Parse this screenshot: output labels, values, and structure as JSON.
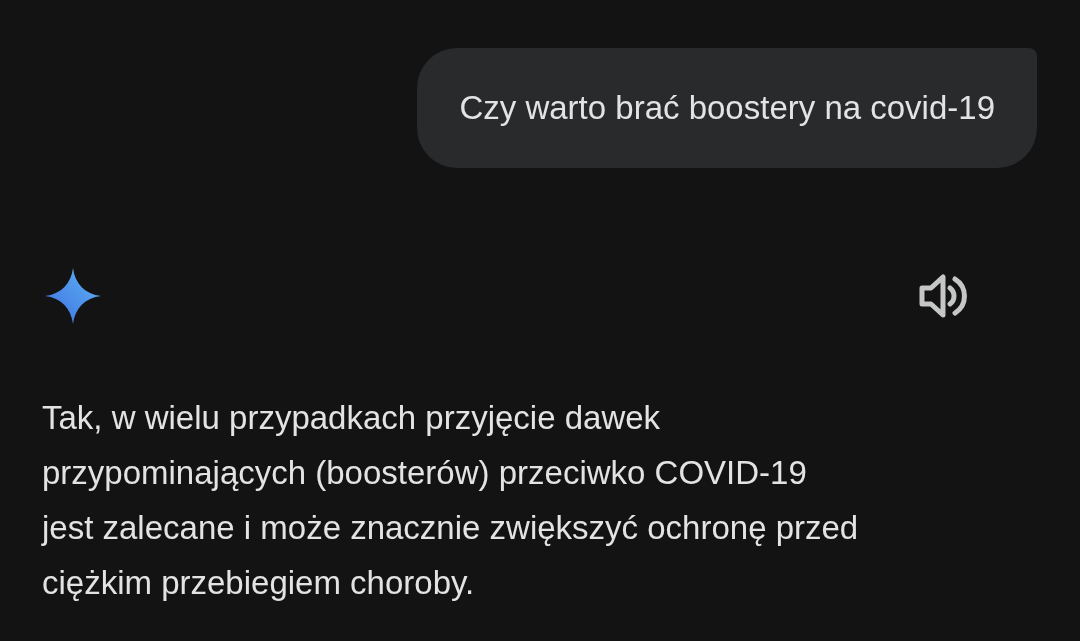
{
  "user_message": {
    "text": "Czy warto brać boostery na covid-19"
  },
  "response": {
    "text": "Tak, w wielu przypadkach przyjęcie dawek\nprzypominających (boosterów) przeciwko COVID-19\njest zalecane i może znacznie zwiększyć ochronę przed\nciężkim przebiegiem choroby."
  }
}
